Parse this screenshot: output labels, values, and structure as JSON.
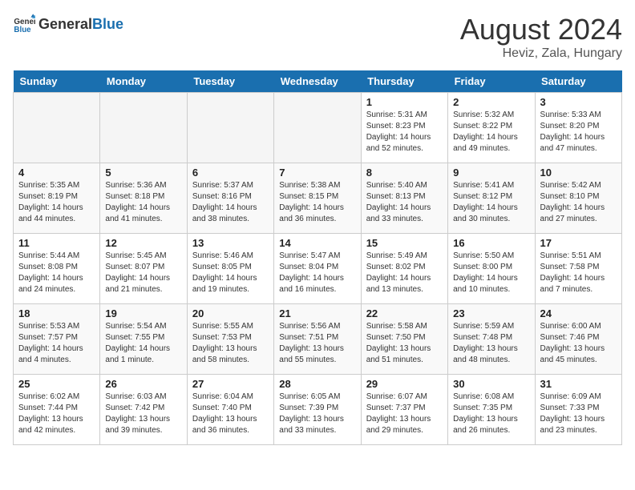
{
  "header": {
    "logo_general": "General",
    "logo_blue": "Blue",
    "month_year": "August 2024",
    "location": "Heviz, Zala, Hungary"
  },
  "weekdays": [
    "Sunday",
    "Monday",
    "Tuesday",
    "Wednesday",
    "Thursday",
    "Friday",
    "Saturday"
  ],
  "weeks": [
    [
      {
        "day": "",
        "info": ""
      },
      {
        "day": "",
        "info": ""
      },
      {
        "day": "",
        "info": ""
      },
      {
        "day": "",
        "info": ""
      },
      {
        "day": "1",
        "info": "Sunrise: 5:31 AM\nSunset: 8:23 PM\nDaylight: 14 hours\nand 52 minutes."
      },
      {
        "day": "2",
        "info": "Sunrise: 5:32 AM\nSunset: 8:22 PM\nDaylight: 14 hours\nand 49 minutes."
      },
      {
        "day": "3",
        "info": "Sunrise: 5:33 AM\nSunset: 8:20 PM\nDaylight: 14 hours\nand 47 minutes."
      }
    ],
    [
      {
        "day": "4",
        "info": "Sunrise: 5:35 AM\nSunset: 8:19 PM\nDaylight: 14 hours\nand 44 minutes."
      },
      {
        "day": "5",
        "info": "Sunrise: 5:36 AM\nSunset: 8:18 PM\nDaylight: 14 hours\nand 41 minutes."
      },
      {
        "day": "6",
        "info": "Sunrise: 5:37 AM\nSunset: 8:16 PM\nDaylight: 14 hours\nand 38 minutes."
      },
      {
        "day": "7",
        "info": "Sunrise: 5:38 AM\nSunset: 8:15 PM\nDaylight: 14 hours\nand 36 minutes."
      },
      {
        "day": "8",
        "info": "Sunrise: 5:40 AM\nSunset: 8:13 PM\nDaylight: 14 hours\nand 33 minutes."
      },
      {
        "day": "9",
        "info": "Sunrise: 5:41 AM\nSunset: 8:12 PM\nDaylight: 14 hours\nand 30 minutes."
      },
      {
        "day": "10",
        "info": "Sunrise: 5:42 AM\nSunset: 8:10 PM\nDaylight: 14 hours\nand 27 minutes."
      }
    ],
    [
      {
        "day": "11",
        "info": "Sunrise: 5:44 AM\nSunset: 8:08 PM\nDaylight: 14 hours\nand 24 minutes."
      },
      {
        "day": "12",
        "info": "Sunrise: 5:45 AM\nSunset: 8:07 PM\nDaylight: 14 hours\nand 21 minutes."
      },
      {
        "day": "13",
        "info": "Sunrise: 5:46 AM\nSunset: 8:05 PM\nDaylight: 14 hours\nand 19 minutes."
      },
      {
        "day": "14",
        "info": "Sunrise: 5:47 AM\nSunset: 8:04 PM\nDaylight: 14 hours\nand 16 minutes."
      },
      {
        "day": "15",
        "info": "Sunrise: 5:49 AM\nSunset: 8:02 PM\nDaylight: 14 hours\nand 13 minutes."
      },
      {
        "day": "16",
        "info": "Sunrise: 5:50 AM\nSunset: 8:00 PM\nDaylight: 14 hours\nand 10 minutes."
      },
      {
        "day": "17",
        "info": "Sunrise: 5:51 AM\nSunset: 7:58 PM\nDaylight: 14 hours\nand 7 minutes."
      }
    ],
    [
      {
        "day": "18",
        "info": "Sunrise: 5:53 AM\nSunset: 7:57 PM\nDaylight: 14 hours\nand 4 minutes."
      },
      {
        "day": "19",
        "info": "Sunrise: 5:54 AM\nSunset: 7:55 PM\nDaylight: 14 hours\nand 1 minute."
      },
      {
        "day": "20",
        "info": "Sunrise: 5:55 AM\nSunset: 7:53 PM\nDaylight: 13 hours\nand 58 minutes."
      },
      {
        "day": "21",
        "info": "Sunrise: 5:56 AM\nSunset: 7:51 PM\nDaylight: 13 hours\nand 55 minutes."
      },
      {
        "day": "22",
        "info": "Sunrise: 5:58 AM\nSunset: 7:50 PM\nDaylight: 13 hours\nand 51 minutes."
      },
      {
        "day": "23",
        "info": "Sunrise: 5:59 AM\nSunset: 7:48 PM\nDaylight: 13 hours\nand 48 minutes."
      },
      {
        "day": "24",
        "info": "Sunrise: 6:00 AM\nSunset: 7:46 PM\nDaylight: 13 hours\nand 45 minutes."
      }
    ],
    [
      {
        "day": "25",
        "info": "Sunrise: 6:02 AM\nSunset: 7:44 PM\nDaylight: 13 hours\nand 42 minutes."
      },
      {
        "day": "26",
        "info": "Sunrise: 6:03 AM\nSunset: 7:42 PM\nDaylight: 13 hours\nand 39 minutes."
      },
      {
        "day": "27",
        "info": "Sunrise: 6:04 AM\nSunset: 7:40 PM\nDaylight: 13 hours\nand 36 minutes."
      },
      {
        "day": "28",
        "info": "Sunrise: 6:05 AM\nSunset: 7:39 PM\nDaylight: 13 hours\nand 33 minutes."
      },
      {
        "day": "29",
        "info": "Sunrise: 6:07 AM\nSunset: 7:37 PM\nDaylight: 13 hours\nand 29 minutes."
      },
      {
        "day": "30",
        "info": "Sunrise: 6:08 AM\nSunset: 7:35 PM\nDaylight: 13 hours\nand 26 minutes."
      },
      {
        "day": "31",
        "info": "Sunrise: 6:09 AM\nSunset: 7:33 PM\nDaylight: 13 hours\nand 23 minutes."
      }
    ]
  ]
}
